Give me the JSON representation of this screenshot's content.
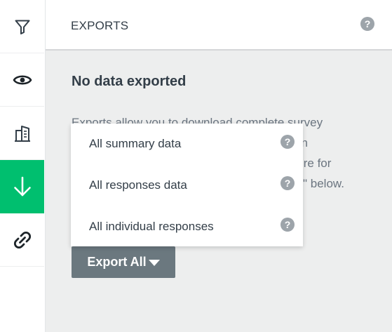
{
  "rail": {
    "items": [
      {
        "name": "filter",
        "icon": "filter-icon",
        "active": false
      },
      {
        "name": "view",
        "icon": "eye-icon",
        "active": false
      },
      {
        "name": "compare",
        "icon": "buildings-icon",
        "active": false
      },
      {
        "name": "exports",
        "icon": "download-arrow-icon",
        "active": true
      },
      {
        "name": "share",
        "icon": "link-icon",
        "active": false
      }
    ],
    "active_color": "#00bf6f"
  },
  "panel": {
    "title": "EXPORTS",
    "help_glyph": "?",
    "empty_title": "No data exported",
    "description_lines": [
      "Exports allow you to download complete survey",
      "on",
      "ar here for",
      "\" below."
    ]
  },
  "menu": {
    "items": [
      {
        "label": "All summary data",
        "help": "?"
      },
      {
        "label": "All responses data",
        "help": "?"
      },
      {
        "label": "All individual responses",
        "help": "?"
      }
    ]
  },
  "export_button": {
    "label": "Export All",
    "color": "#6b787f"
  }
}
